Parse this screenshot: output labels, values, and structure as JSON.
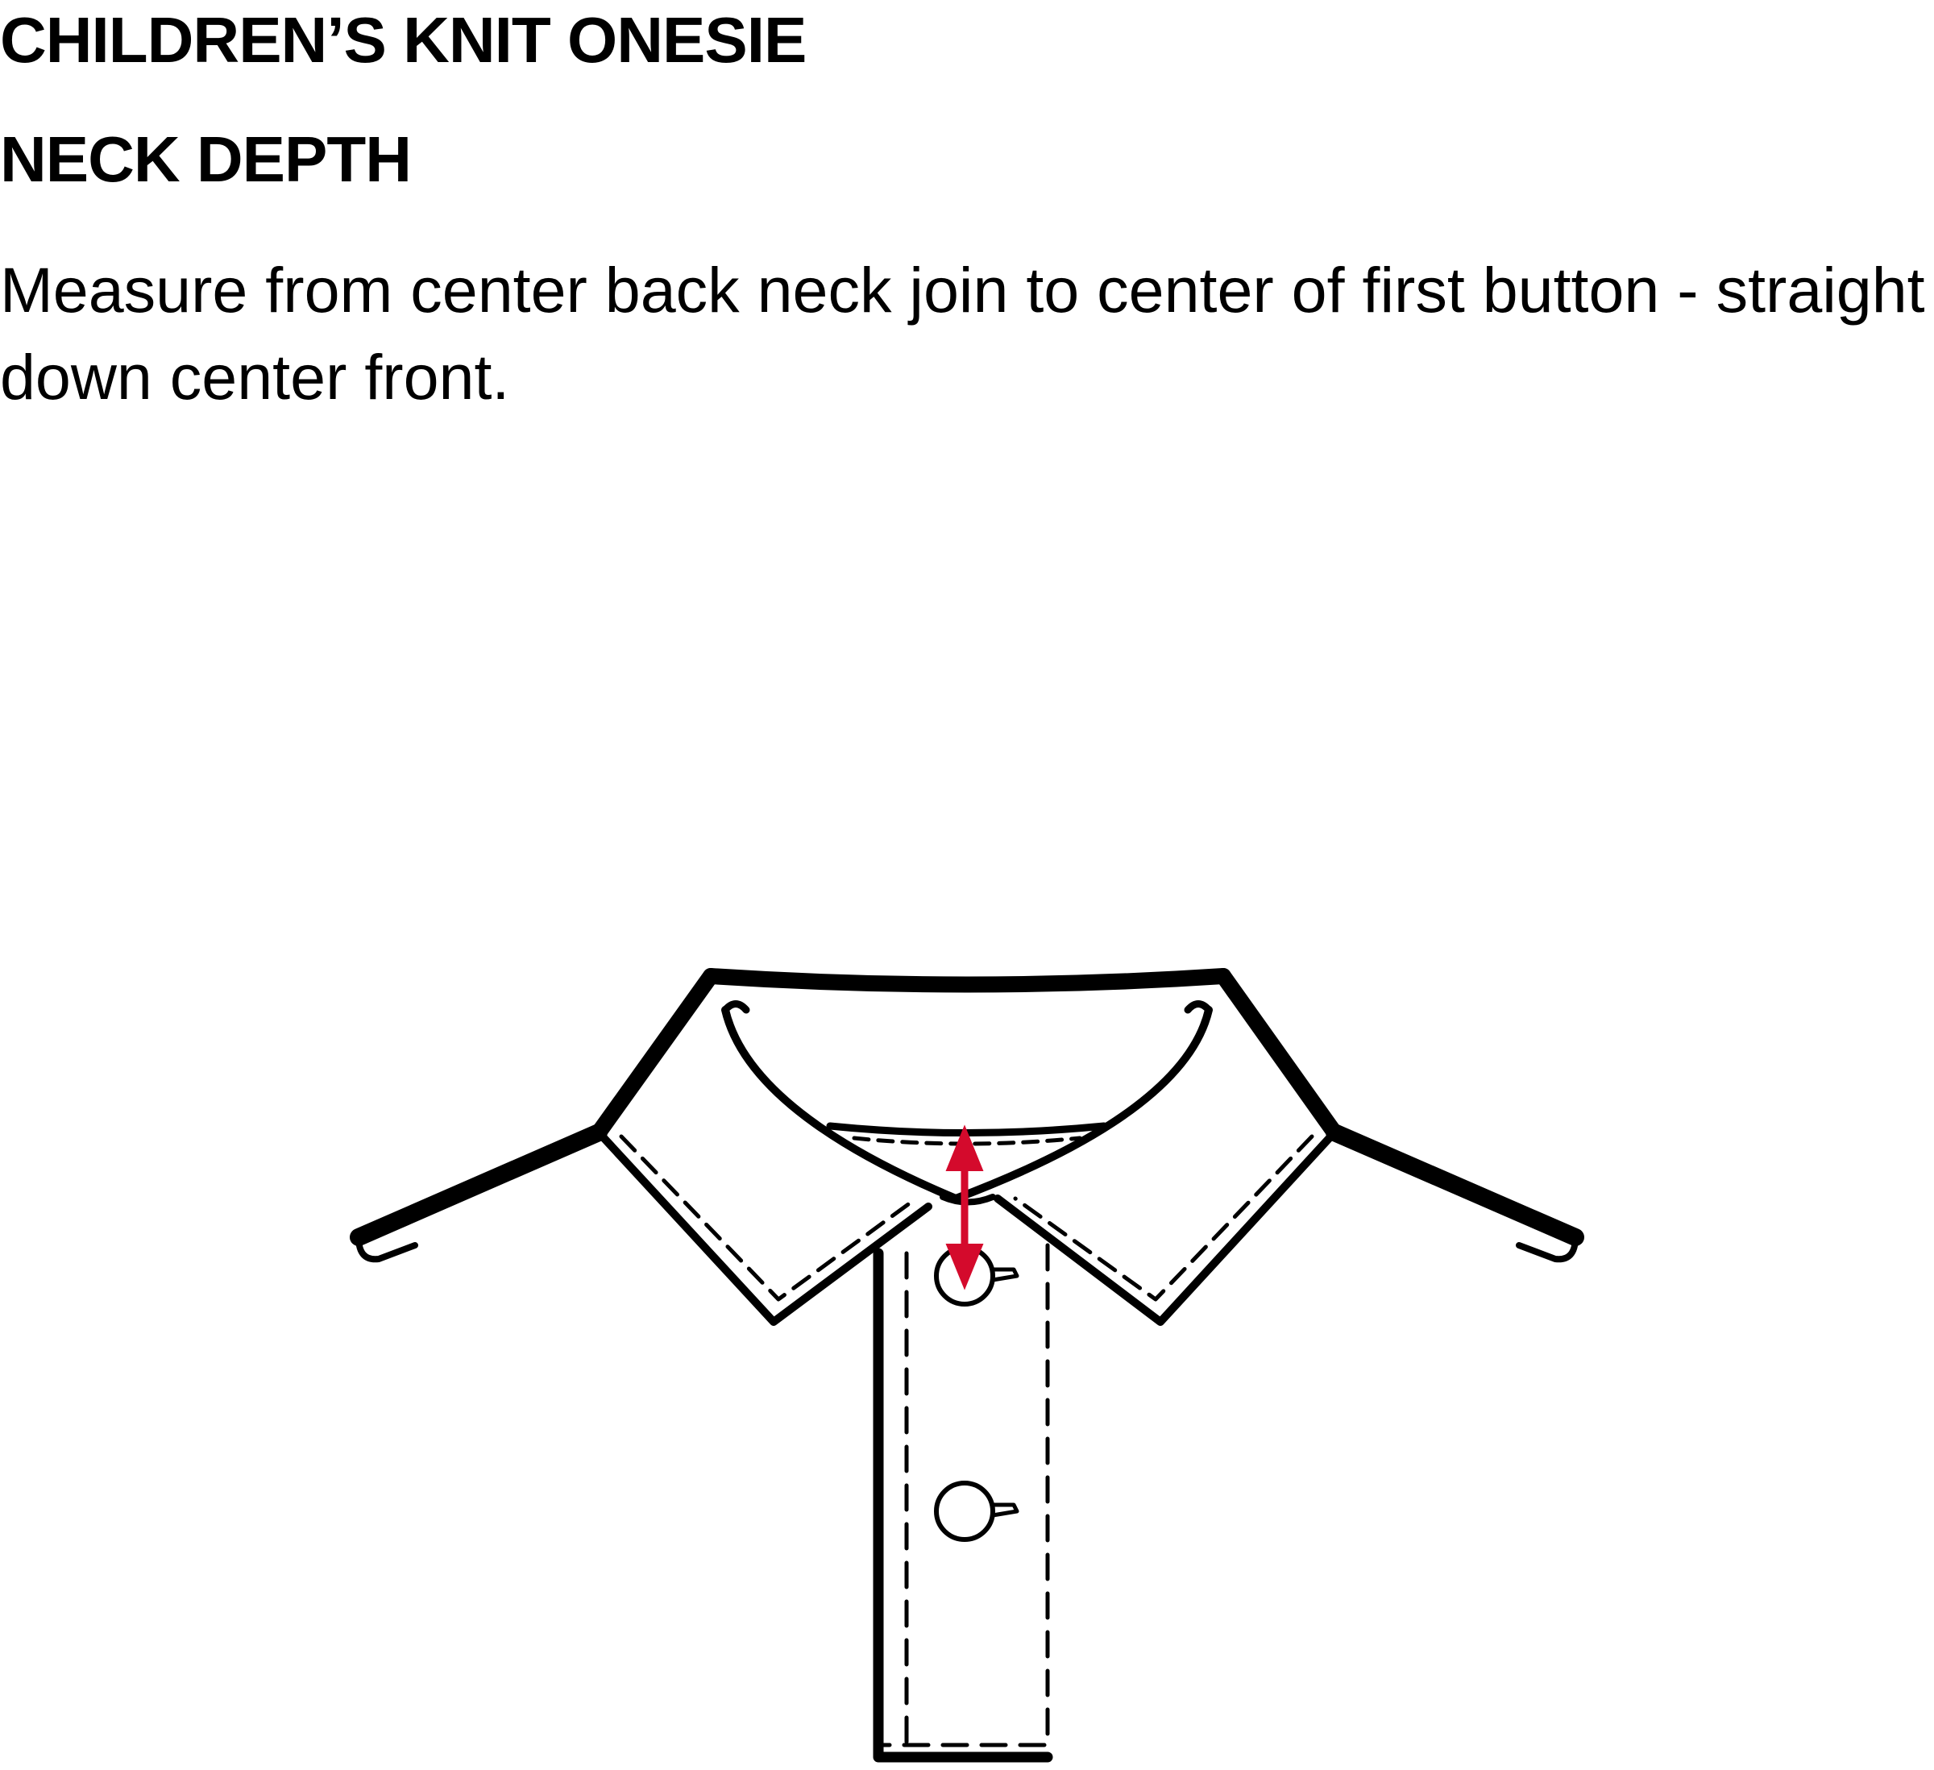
{
  "header": {
    "title": "CHILDREN’S KNIT ONESIE",
    "measurement_name": "NECK DEPTH"
  },
  "instructions": {
    "text": "Measure from center back neck join to center of first button - straight down center front."
  },
  "diagram": {
    "measurement_arrow_color": "#d40a2c",
    "line_color": "#000000"
  }
}
